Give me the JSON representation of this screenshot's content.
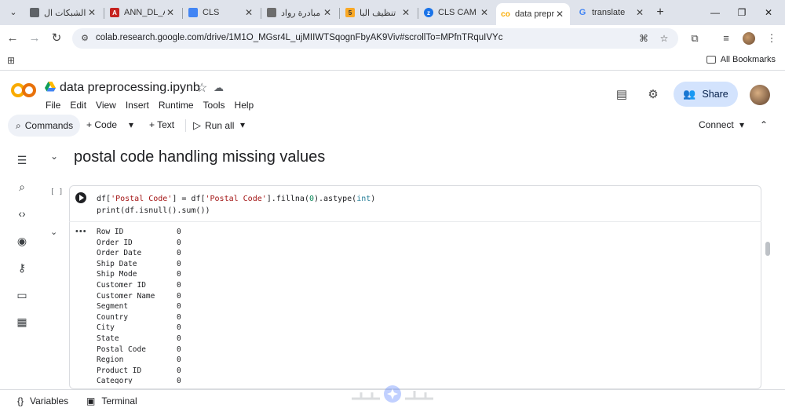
{
  "browser": {
    "tabs": [
      {
        "title": "الشبكات ال",
        "favicon_color": "#5f6368"
      },
      {
        "title": "ANN_DL_A",
        "favicon_color": "#c5221f"
      },
      {
        "title": "CLS",
        "favicon_color": "#4285f4"
      },
      {
        "title": "مبادرة رواد",
        "favicon_color": "#6d6d6d"
      },
      {
        "title": "تنظيف البا",
        "favicon_color": "#f9a825"
      },
      {
        "title": "CLS CAM",
        "favicon_color": "#1a73e8"
      },
      {
        "title": "data prepr",
        "favicon_color": "#f9ab00",
        "active": true
      },
      {
        "title": "translate",
        "favicon_color": "#4285f4"
      }
    ],
    "url": "colab.research.google.com/drive/1M1O_MGsr4L_ujMIIWTSqognFbyAK9Viv#scrollTo=MPfnTRquIVYc",
    "all_bookmarks": "All Bookmarks"
  },
  "colab": {
    "notebook_title": "data preprocessing.ipynb",
    "menu": [
      "File",
      "Edit",
      "View",
      "Insert",
      "Runtime",
      "Tools",
      "Help"
    ],
    "share_label": "Share",
    "toolbar": {
      "commands": "Commands",
      "code": "+ Code",
      "text": "+ Text",
      "run_all": "Run all",
      "connect": "Connect"
    },
    "section_title": "postal code handling missing values",
    "cell": {
      "exec_count": "[ ]",
      "code_line1": "df['Postal Code'] = df['Postal Code'].fillna(0).astype(int)",
      "code_line2": "print(df.isnull().sum())",
      "output": [
        {
          "key": "Row ID",
          "value": "0"
        },
        {
          "key": "Order ID",
          "value": "0"
        },
        {
          "key": "Order Date",
          "value": "0"
        },
        {
          "key": "Ship Date",
          "value": "0"
        },
        {
          "key": "Ship Mode",
          "value": "0"
        },
        {
          "key": "Customer ID",
          "value": "0"
        },
        {
          "key": "Customer Name",
          "value": "0"
        },
        {
          "key": "Segment",
          "value": "0"
        },
        {
          "key": "Country",
          "value": "0"
        },
        {
          "key": "City",
          "value": "0"
        },
        {
          "key": "State",
          "value": "0"
        },
        {
          "key": "Postal Code",
          "value": "0"
        },
        {
          "key": "Region",
          "value": "0"
        },
        {
          "key": "Product ID",
          "value": "0"
        },
        {
          "key": "Category",
          "value": "0"
        }
      ]
    },
    "bottom": {
      "variables": "Variables",
      "terminal": "Terminal"
    }
  }
}
